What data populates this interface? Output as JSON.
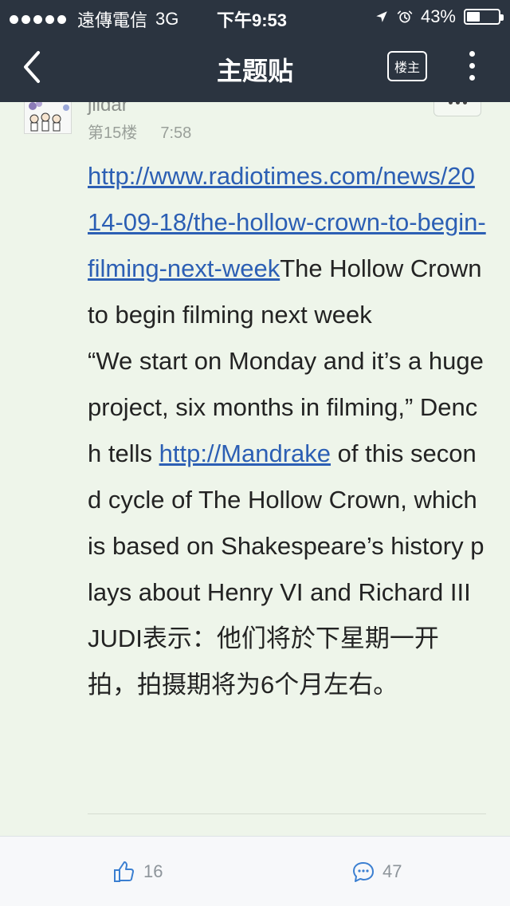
{
  "status": {
    "carrier": "遠傳電信",
    "network": "3G",
    "time": "下午9:53",
    "battery": "43%",
    "icons": [
      "location-arrow-icon",
      "alarm-clock-icon",
      "battery-icon"
    ]
  },
  "nav": {
    "title": "主题贴",
    "owner_label": "楼主",
    "icons": {
      "back": "chevron-left-icon",
      "more": "more-vertical-icon"
    }
  },
  "post": {
    "username": "jildar",
    "floor": "第15楼",
    "time": "7:58",
    "link1": "http://www.radiotimes.com/news/2014-09-18/the-hollow-crown-to-begin-filming-next-week",
    "text1": "The Hollow Crown to begin filming next week",
    "text2": "“We start on Monday and it’s a huge project, six months in filming,” Dench tells",
    "link2": "http://Mandrake",
    "text3": "of this second cycle of The Hollow Crown, which is based on Shakespeare’s history plays about Henry VI and Richard III",
    "text4": "JUDI表示：他们将於下星期一开拍，拍摄期将为6个月左右。"
  },
  "actions": {
    "likes": "16",
    "comments": "47",
    "icons": {
      "like": "thumbs-up-icon",
      "comment": "speech-bubble-icon"
    }
  },
  "colors": {
    "topbar": "#2b3440",
    "background": "#eef5ea",
    "link": "#2c5fb4",
    "action_icon": "#3b7fd1"
  }
}
